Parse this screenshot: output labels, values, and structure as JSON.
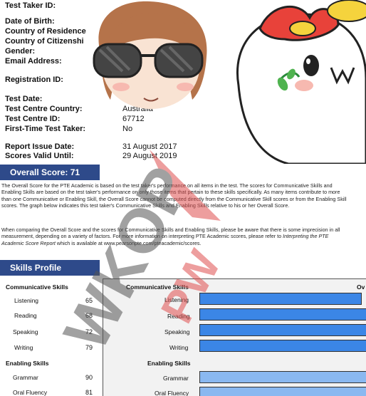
{
  "fields": {
    "test_taker_id": "Test Taker ID:",
    "date_of_birth": "Date of Birth:",
    "country_of_residence": "Country of Residence",
    "country_of_citizenship": "Country of Citizenshi",
    "gender": "Gender:",
    "email": "Email Address:",
    "registration_id": "Registration ID:",
    "test_date": "Test Date:",
    "test_centre_country": "Test Centre Country:",
    "test_centre_country_value": "Australia",
    "test_centre_id": "Test Centre ID:",
    "test_centre_id_value": "67712",
    "first_time": "First-Time Test Taker:",
    "first_time_value": "No",
    "report_issue_date": "Report Issue Date:",
    "report_issue_date_value": "31 August 2017",
    "scores_valid_until": "Scores Valid Until:",
    "scores_valid_until_value": "29 August 2019"
  },
  "overall": {
    "banner": "Overall Score: 71"
  },
  "paragraphs": {
    "p1": "The Overall Score for the PTE Academic is based on the test taker's performance on all items in the test.  The scores for Communicative Skills and Enabling Skills are based on the test taker's performance on only those items that pertain to these skills specifically.  As many items contribute to more than one Communicative or Enabling Skill, the Overall Score cannot be computed directly from the Communicative Skill scores or from the Enabling Skill scores.  The graph below indicates this test taker's Communicative Skills and Enabling Skills relative to his or her Overall Score.",
    "p2_start": "When comparing the Overall Score and the scores for Communicative Skills and Enabling Skills, please be aware that there is some imprecision in all measurement, depending on a variety of factors.  For more information on interpreting PTE Academic scores, please refer to ",
    "p2_link": "Interpreting the PTE Academic Score Report",
    "p2_end": " which is available at www.pearsonpte.com/pteacademic/scores."
  },
  "skills_profile": {
    "banner": "Skills Profile",
    "communicative_heading": "Communicative Skills",
    "enabling_heading": "Enabling Skills",
    "chart_overall_label": "Ov",
    "communicative": [
      {
        "name": "Listening",
        "score": "65"
      },
      {
        "name": "Reading",
        "score": "68"
      },
      {
        "name": "Speaking",
        "score": "72"
      },
      {
        "name": "Writing",
        "score": "79"
      }
    ],
    "enabling": [
      {
        "name": "Grammar",
        "score": "90"
      },
      {
        "name": "Oral Fluency",
        "score": "81"
      }
    ]
  },
  "colors": {
    "banner": "#2e4a8a",
    "communicative_bar": "#3b86e6",
    "enabling_bar": "#8ab8f0",
    "watermark": "#e05050"
  }
}
